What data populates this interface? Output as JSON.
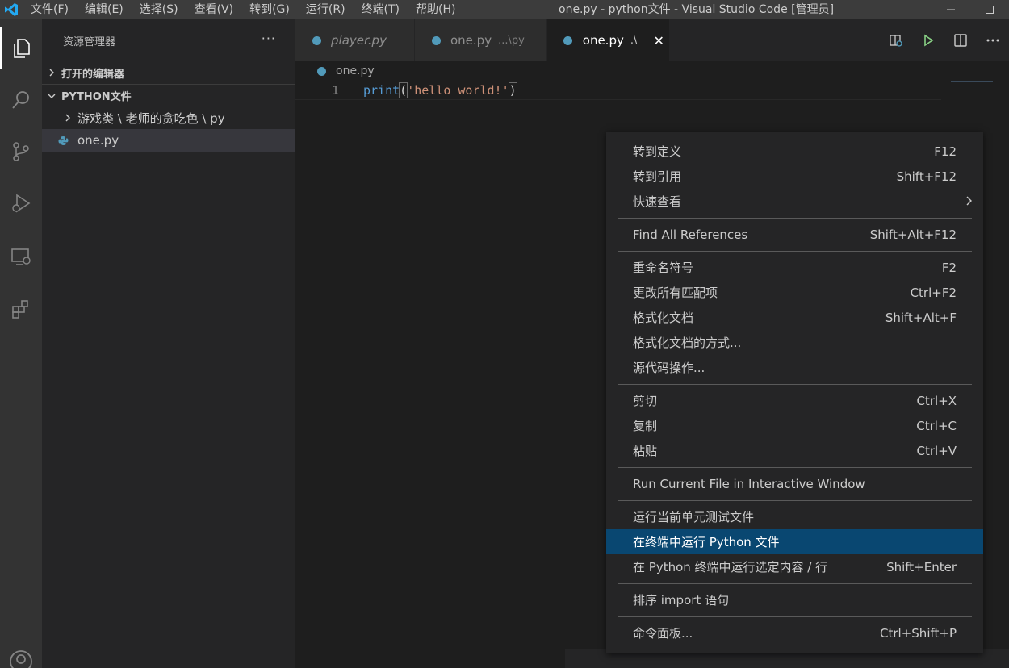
{
  "menubar": {
    "items": [
      "文件(F)",
      "编辑(E)",
      "选择(S)",
      "查看(V)",
      "转到(G)",
      "运行(R)",
      "终端(T)",
      "帮助(H)"
    ]
  },
  "window": {
    "title": "one.py - python文件 - Visual Studio Code [管理员]"
  },
  "sidebar": {
    "title": "资源管理器",
    "more": "···",
    "open_editors_label": "打开的编辑器",
    "folder_label": "PYTHON文件",
    "tree": {
      "folder_path": "游戏类 \\ 老师的贪吃色 \\ py",
      "file": "one.py"
    }
  },
  "tabs": [
    {
      "label": "player.py",
      "desc": ""
    },
    {
      "label": "one.py",
      "desc": "...\\py"
    },
    {
      "label": "one.py",
      "desc": ".\\",
      "close": "✕"
    }
  ],
  "editor": {
    "breadcrumb": "one.py",
    "line_number": "1",
    "code": {
      "fn": "print",
      "open": "(",
      "str": "'hello world!'",
      "close": ")"
    }
  },
  "context_menu": {
    "items": [
      {
        "label": "转到定义",
        "shortcut": "F12"
      },
      {
        "label": "转到引用",
        "shortcut": "Shift+F12"
      },
      {
        "label": "快速查看",
        "shortcut": ""
      },
      {
        "label": "Find All References",
        "shortcut": "Shift+Alt+F12"
      },
      {
        "label": "重命名符号",
        "shortcut": "F2"
      },
      {
        "label": "更改所有匹配项",
        "shortcut": "Ctrl+F2"
      },
      {
        "label": "格式化文档",
        "shortcut": "Shift+Alt+F"
      },
      {
        "label": "格式化文档的方式...",
        "shortcut": ""
      },
      {
        "label": "源代码操作...",
        "shortcut": ""
      },
      {
        "label": "剪切",
        "shortcut": "Ctrl+X"
      },
      {
        "label": "复制",
        "shortcut": "Ctrl+C"
      },
      {
        "label": "粘贴",
        "shortcut": "Ctrl+V"
      },
      {
        "label": "Run Current File in Interactive Window",
        "shortcut": ""
      },
      {
        "label": "运行当前单元测试文件",
        "shortcut": ""
      },
      {
        "label": "在终端中运行 Python 文件",
        "shortcut": ""
      },
      {
        "label": "在 Python 终端中运行选定内容 / 行",
        "shortcut": "Shift+Enter"
      },
      {
        "label": "排序 import 语句",
        "shortcut": ""
      },
      {
        "label": "命令面板...",
        "shortcut": "Ctrl+Shift+P"
      }
    ]
  },
  "colors": {
    "accent": "#007acc",
    "highlight": "#094771",
    "python_icon": "#519aba"
  },
  "icons": [
    "vscode-logo-icon",
    "files-icon",
    "search-icon",
    "source-control-icon",
    "run-debug-icon",
    "remote-explorer-icon",
    "extensions-icon",
    "account-icon",
    "python-file-icon",
    "chevron-right-icon",
    "chevron-down-icon",
    "close-icon",
    "open-preview-icon",
    "run-icon",
    "split-editor-icon",
    "more-actions-icon",
    "minimize-icon",
    "maximize-icon"
  ]
}
